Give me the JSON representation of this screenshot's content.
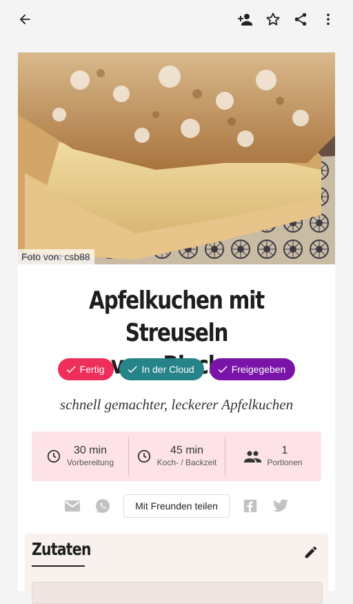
{
  "toolbar": {
    "back_icon": "arrow-back-icon",
    "add_person_icon": "person-add-icon",
    "favorite_icon": "star-outline-icon",
    "share_icon": "share-icon",
    "more_icon": "more-vert-icon"
  },
  "recipe": {
    "photo_credit": "Foto von: csb88",
    "title_line1": "Apfelkuchen mit Streuseln",
    "title_line2": "vom Blech",
    "subtitle": "schnell gemachter, leckerer Apfelkuchen",
    "badges": [
      {
        "label": "Fertig",
        "color": "#ef2f5b"
      },
      {
        "label": "In der Cloud",
        "color": "#268389"
      },
      {
        "label": "Freigegeben",
        "color": "#7a14a8"
      }
    ],
    "times": [
      {
        "value": "30 min",
        "label": "Vorbereitung",
        "icon": "clock-icon"
      },
      {
        "value": "45 min",
        "label": "Koch- / Backzeit",
        "icon": "clock-icon"
      },
      {
        "value": "1",
        "label": "Portionen",
        "icon": "people-icon"
      }
    ]
  },
  "share": {
    "button_label": "Mit Freunden teilen",
    "icons": [
      "email-icon",
      "whatsapp-icon",
      "facebook-icon",
      "twitter-icon"
    ]
  },
  "ingredients": {
    "title": "Zutaten"
  },
  "colors": {
    "times_bg": "#fde3e8",
    "ingredients_bg": "#f8f1ee"
  }
}
